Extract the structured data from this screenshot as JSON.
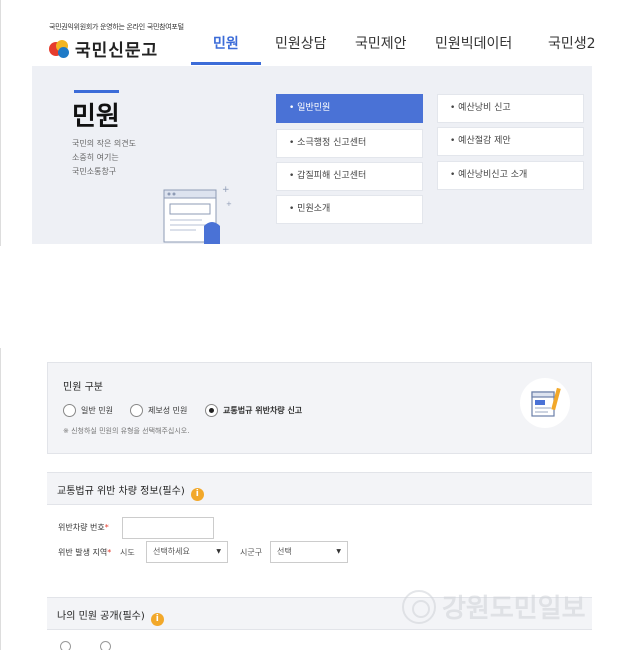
{
  "header": {
    "logo_sub": "국민권익위원회가 운영하는 온라인 국민참여포털",
    "logo_name": "국민신문고",
    "nav": [
      "민원",
      "민원상담",
      "국민제안",
      "민원빅데이터",
      "국민생2"
    ],
    "active_nav_index": 0
  },
  "mega": {
    "title": "민원",
    "desc": [
      "국민의 작은 의견도",
      "소중히 여기는",
      "국민소통창구"
    ],
    "col1": [
      "일반민원",
      "소극행정 신고센터",
      "갑질피해 신고센터",
      "민원소개"
    ],
    "col1_active_index": 0,
    "col2": [
      "예산낭비 신고",
      "예산절감 제안",
      "예산낭비신고 소개"
    ]
  },
  "form": {
    "type_label": "민원 구분",
    "radios": [
      {
        "label": "일반 민원",
        "checked": false
      },
      {
        "label": "제보성 민원",
        "checked": false
      },
      {
        "label": "교통법규 위반차량 신고",
        "checked": true
      }
    ],
    "note": "※ 신청하실 민원의 유형을 선택해주십시오.",
    "section1_title": "교통법규 위반 차량 정보(필수)",
    "plate_label": "위반차량 번호",
    "region_label": "위반 발생 지역",
    "sido_label": "시도",
    "sido_value": "선택하세요",
    "sigungu_label": "시군구",
    "sigungu_value": "선택",
    "required_mark": "*",
    "info_icon": "i",
    "section2_title": "나의 민원 공개(필수)"
  },
  "watermark": "강원도민일보",
  "colors": {
    "accent": "#3c6cd8",
    "active_menu": "#4a72d6",
    "info": "#f2a82a",
    "required": "#e63d2e"
  }
}
